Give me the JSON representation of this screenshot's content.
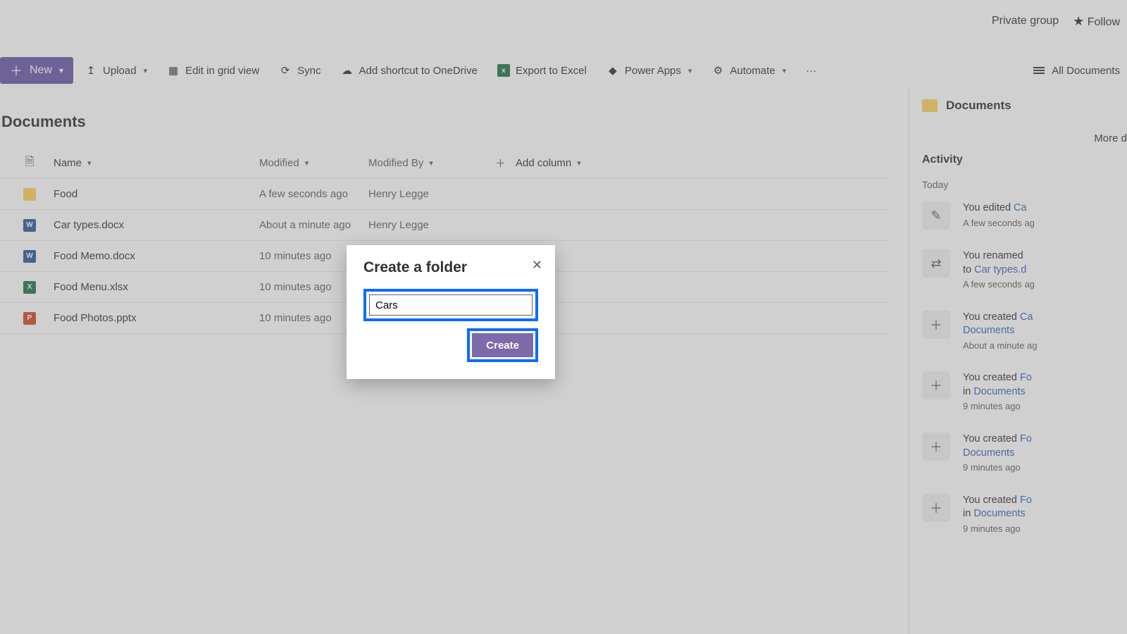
{
  "header": {
    "privateGroup": "Private group",
    "follow": "Follow"
  },
  "commandBar": {
    "new": "New",
    "upload": "Upload",
    "editGrid": "Edit in grid view",
    "sync": "Sync",
    "addShortcut": "Add shortcut to OneDrive",
    "exportExcel": "Export to Excel",
    "powerApps": "Power Apps",
    "automate": "Automate",
    "viewName": "All Documents"
  },
  "pageTitle": "Documents",
  "table": {
    "columns": {
      "name": "Name",
      "modified": "Modified",
      "modifiedBy": "Modified By",
      "addColumn": "Add column"
    },
    "rows": [
      {
        "icon": "folder",
        "name": "Food",
        "modified": "A few seconds ago",
        "by": "Henry Legge"
      },
      {
        "icon": "word",
        "name": "Car types.docx",
        "modified": "About a minute ago",
        "by": "Henry Legge"
      },
      {
        "icon": "word",
        "name": "Food Memo.docx",
        "modified": "10 minutes ago",
        "by": ""
      },
      {
        "icon": "excel",
        "name": "Food Menu.xlsx",
        "modified": "10 minutes ago",
        "by": ""
      },
      {
        "icon": "ppt",
        "name": "Food Photos.pptx",
        "modified": "10 minutes ago",
        "by": ""
      }
    ]
  },
  "rightPanel": {
    "title": "Documents",
    "moreDetails": "More d",
    "activityHeader": "Activity",
    "today": "Today",
    "items": [
      {
        "icon": "edit",
        "line1a": "You edited ",
        "link1": "Ca",
        "line2a": "",
        "link2": "",
        "time": "A few seconds ag"
      },
      {
        "icon": "rename",
        "line1a": "You renamed ",
        "link1": "",
        "line2a": "to ",
        "link2": "Car types.d",
        "time": "A few seconds ag"
      },
      {
        "icon": "plus",
        "line1a": "You created ",
        "link1": "Ca",
        "line2a": "",
        "link2": "Documents",
        "time": "About a minute ag"
      },
      {
        "icon": "plus",
        "line1a": "You created ",
        "link1": "Fo",
        "line2a": "in ",
        "link2": "Documents",
        "time": "9 minutes ago"
      },
      {
        "icon": "plus",
        "line1a": "You created ",
        "link1": "Fo",
        "line2a": "",
        "link2": "Documents",
        "time": "9 minutes ago"
      },
      {
        "icon": "plus",
        "line1a": "You created ",
        "link1": "Fo",
        "line2a": "in ",
        "link2": "Documents",
        "time": "9 minutes ago"
      }
    ]
  },
  "modal": {
    "title": "Create a folder",
    "value": "Cars",
    "create": "Create"
  }
}
